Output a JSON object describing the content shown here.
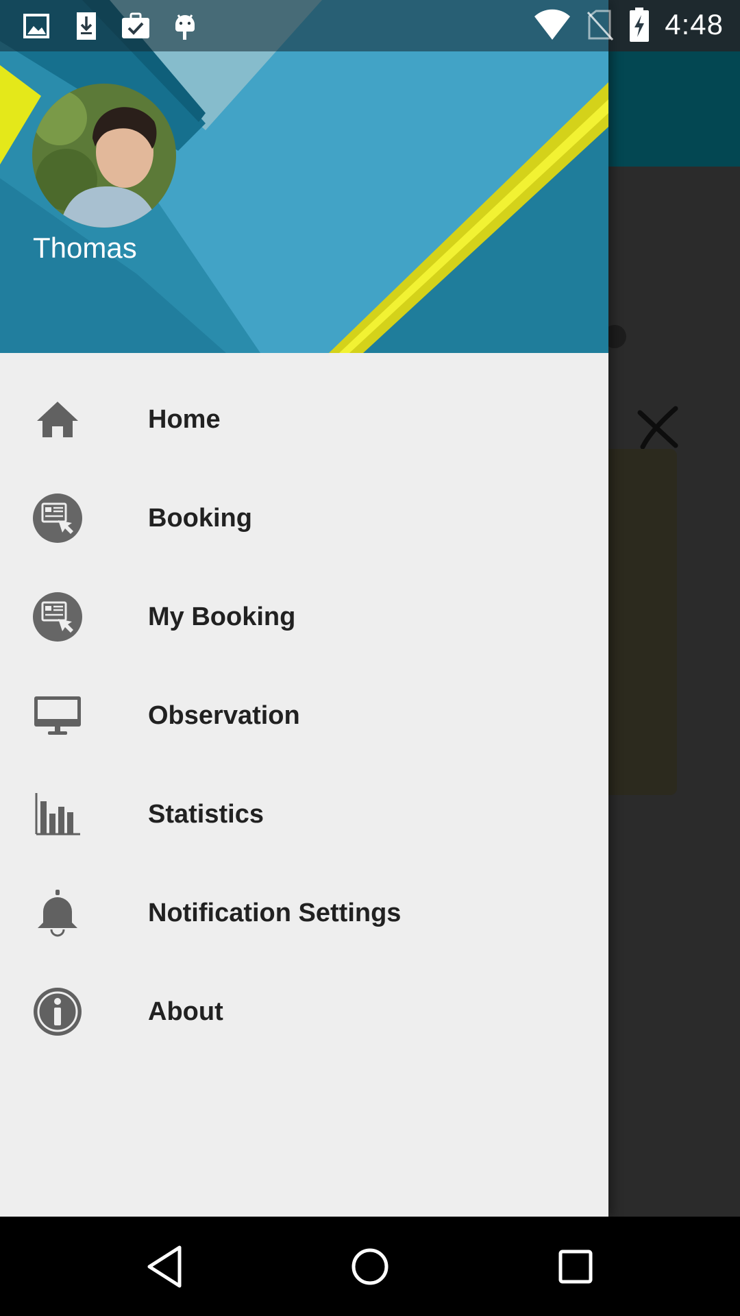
{
  "status_bar": {
    "time": "4:48",
    "left_icons": [
      "image-icon",
      "download-icon",
      "clipboard-check-icon",
      "android-icon"
    ],
    "right_icons": [
      "wifi-icon",
      "no-sim-icon",
      "battery-charging-icon"
    ]
  },
  "drawer": {
    "user": {
      "name": "Thomas"
    },
    "menu": [
      {
        "label": "Home",
        "icon": "home-icon"
      },
      {
        "label": "Booking",
        "icon": "booking-icon"
      },
      {
        "label": "My Booking",
        "icon": "booking-icon"
      },
      {
        "label": "Observation",
        "icon": "monitor-icon"
      },
      {
        "label": "Statistics",
        "icon": "bar-chart-icon"
      },
      {
        "label": "Notification Settings",
        "icon": "bell-icon"
      },
      {
        "label": "About",
        "icon": "info-icon"
      }
    ]
  },
  "nav_bar": {
    "buttons": [
      "back-icon",
      "home-circle-icon",
      "recents-icon"
    ]
  },
  "colors": {
    "drawer_bg": "#eeeeee",
    "header_blue": "#3a96b6",
    "accent_yellow": "#e1e518",
    "icon_gray": "#616161",
    "toolbar_teal": "#034752"
  }
}
